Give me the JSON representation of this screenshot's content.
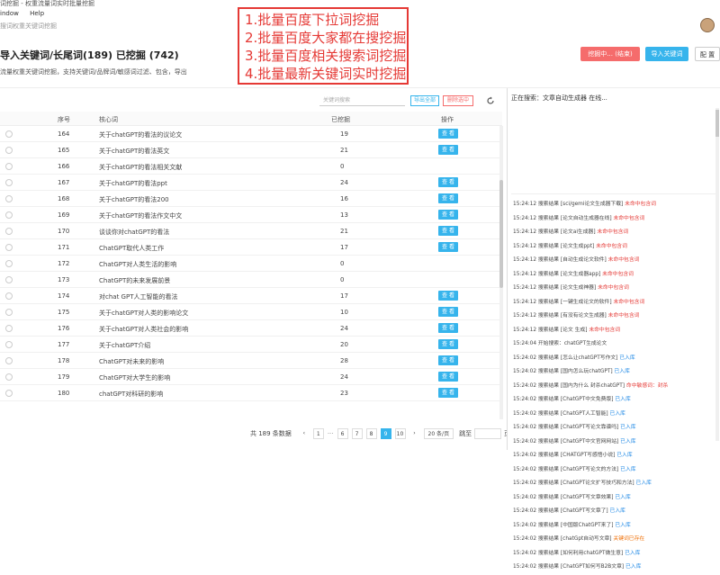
{
  "window": {
    "title": "词挖掘 - 权重流量词实时批量挖掘"
  },
  "menubar": {
    "items": [
      "indow",
      "Help"
    ]
  },
  "breadcrumb": "搜词权重关键词挖掘",
  "page": {
    "title": "导入关键词/长尾词(189) 已挖掘 (742)",
    "description": "流量权重关键词挖掘，支持关键词/品牌词/敏感词过滤、包含，导出"
  },
  "buttons": {
    "mining": "挖掘中... (结束)",
    "import": "导入关键词",
    "config": "配 置"
  },
  "overlay": {
    "lines": [
      "1.批量百度下拉词挖掘",
      "2.批量百度大家都在搜挖掘",
      "3.批量百度相关搜索词挖掘",
      "4.批量最新关键词实时挖掘"
    ]
  },
  "toolbar": {
    "search_placeholder": "关键词搜索",
    "export_label": "导出全部",
    "delete_label": "删除选中"
  },
  "table": {
    "headers": {
      "seq": "序号",
      "keyword": "核心词",
      "count": "已挖掘",
      "action": "操作"
    },
    "rows": [
      {
        "seq": "164",
        "keyword": "关于chatGPT的看法的议论文",
        "count": "19",
        "view": "查 看"
      },
      {
        "seq": "165",
        "keyword": "关于chatGPT的看法英文",
        "count": "21",
        "view": "查 看"
      },
      {
        "seq": "166",
        "keyword": "关于chatGPT的看法相关文献",
        "count": "0",
        "view": ""
      },
      {
        "seq": "167",
        "keyword": "关于chatGPT的看法ppt",
        "count": "24",
        "view": "查 看"
      },
      {
        "seq": "168",
        "keyword": "关于chatGPT的看法200",
        "count": "16",
        "view": "查 看"
      },
      {
        "seq": "169",
        "keyword": "关于chatGPT的看法作文中文",
        "count": "13",
        "view": "查 看"
      },
      {
        "seq": "170",
        "keyword": "谈谈你对chatGPT的看法",
        "count": "21",
        "view": "查 看"
      },
      {
        "seq": "171",
        "keyword": "ChatGPT取代人类工作",
        "count": "17",
        "view": "查 看"
      },
      {
        "seq": "172",
        "keyword": "ChatGPT对人类生活的影响",
        "count": "0",
        "view": ""
      },
      {
        "seq": "173",
        "keyword": "ChatGPT的未来发展前景",
        "count": "0",
        "view": ""
      },
      {
        "seq": "174",
        "keyword": "对chat GPT人工智能的看法",
        "count": "17",
        "view": "查 看"
      },
      {
        "seq": "175",
        "keyword": "关于chatGPT对人类的影响论文",
        "count": "10",
        "view": "查 看"
      },
      {
        "seq": "176",
        "keyword": "关于chatGPT对人类社会的影响",
        "count": "24",
        "view": "查 看"
      },
      {
        "seq": "177",
        "keyword": "关于chatGPT介绍",
        "count": "20",
        "view": "查 看"
      },
      {
        "seq": "178",
        "keyword": "ChatGPT对未来的影响",
        "count": "28",
        "view": "查 看"
      },
      {
        "seq": "179",
        "keyword": "ChatGPT对大学生的影响",
        "count": "24",
        "view": "查 看"
      },
      {
        "seq": "180",
        "keyword": "chatGPT对科研的影响",
        "count": "23",
        "view": "查 看"
      }
    ]
  },
  "pager": {
    "total": "共 189 条数据",
    "prev": "‹",
    "pages": [
      "1",
      "6",
      "7",
      "8",
      "9",
      "10"
    ],
    "active_index": 4,
    "next": "›",
    "page_size": "20 条/页",
    "jump_label": "跳至",
    "page_unit": "页"
  },
  "log_panel": {
    "status": "正在搜索：文章自动生成器 在线...",
    "lines": [
      {
        "t": "15:24:12 搜索结果 [sci/gemi论文生成器下载] ",
        "s": "未命中包含词",
        "c": "red"
      },
      {
        "t": "15:24:12 搜索结果 [论文自动生成器在线] ",
        "s": "未命中包含词",
        "c": "red"
      },
      {
        "t": "15:24:12 搜索结果 [论文ai生成器] ",
        "s": "未命中包含词",
        "c": "red"
      },
      {
        "t": "15:24:12 搜索结果 [论文生成ppt] ",
        "s": "未命中包含词",
        "c": "red"
      },
      {
        "t": "15:24:12 搜索结果 [自动生成论文软件] ",
        "s": "未命中包含词",
        "c": "red"
      },
      {
        "t": "15:24:12 搜索结果 [论文生成器app] ",
        "s": "未命中包含词",
        "c": "red"
      },
      {
        "t": "15:24:12 搜索结果 [论文生成神器] ",
        "s": "未命中包含词",
        "c": "red"
      },
      {
        "t": "15:24:12 搜索结果 [一键生成论文的软件] ",
        "s": "未命中包含词",
        "c": "red"
      },
      {
        "t": "15:24:12 搜索结果 [有没有论文生成器] ",
        "s": "未命中包含词",
        "c": "red"
      },
      {
        "t": "15:24:12 搜索结果 [论文 生成] ",
        "s": "未命中包含词",
        "c": "red"
      },
      {
        "t": "15:24:04 开始搜索：chatGPT生成论文",
        "s": "",
        "c": ""
      },
      {
        "t": "15:24:02 搜索结果 [怎么让chatGPT写作文] ",
        "s": "已入库",
        "c": "blue"
      },
      {
        "t": "15:24:02 搜索结果 [国内怎么玩chatGPT] ",
        "s": "已入库",
        "c": "blue"
      },
      {
        "t": "15:24:02 搜索结果 [国内为什么 封杀chatGPT] ",
        "s": "命中敏感词：封杀",
        "c": "red"
      },
      {
        "t": "15:24:02 搜索结果 [ChatGPT中文免费版] ",
        "s": "已入库",
        "c": "blue"
      },
      {
        "t": "15:24:02 搜索结果 [ChatGPT人工智能] ",
        "s": "已入库",
        "c": "blue"
      },
      {
        "t": "15:24:02 搜索结果 [ChatGPT写论文靠谱吗] ",
        "s": "已入库",
        "c": "blue"
      },
      {
        "t": "15:24:02 搜索结果 [ChatGPT中文官网网站] ",
        "s": "已入库",
        "c": "blue"
      },
      {
        "t": "15:24:02 搜索结果 [CHATGPT写感悟小说] ",
        "s": "已入库",
        "c": "blue"
      },
      {
        "t": "15:24:02 搜索结果 [ChatGPT写论文的方法] ",
        "s": "已入库",
        "c": "blue"
      },
      {
        "t": "15:24:02 搜索结果 [ChatGPT论文扩写技巧和方法] ",
        "s": "已入库",
        "c": "blue"
      },
      {
        "t": "15:24:02 搜索结果 [ChatGPT写文章效果] ",
        "s": "已入库",
        "c": "blue"
      },
      {
        "t": "15:24:02 搜索结果 [ChatGPT写文章了] ",
        "s": "已入库",
        "c": "blue"
      },
      {
        "t": "15:24:02 搜索结果 [中国版ChatGPT来了] ",
        "s": "已入库",
        "c": "blue"
      },
      {
        "t": "15:24:02 搜索结果 [chatGpt自动写文章] ",
        "s": "关键词已存在",
        "c": "orange"
      },
      {
        "t": "15:24:02 搜索结果 [如何利用chatGPT做生意] ",
        "s": "已入库",
        "c": "blue"
      },
      {
        "t": "15:24:02 搜索结果 [ChatGPT如何写B2B文章] ",
        "s": "已入库",
        "c": "blue"
      }
    ]
  },
  "colors": {
    "accent": "#36b4ec",
    "danger": "#f56c6c",
    "overlay_red": "#e53935"
  }
}
